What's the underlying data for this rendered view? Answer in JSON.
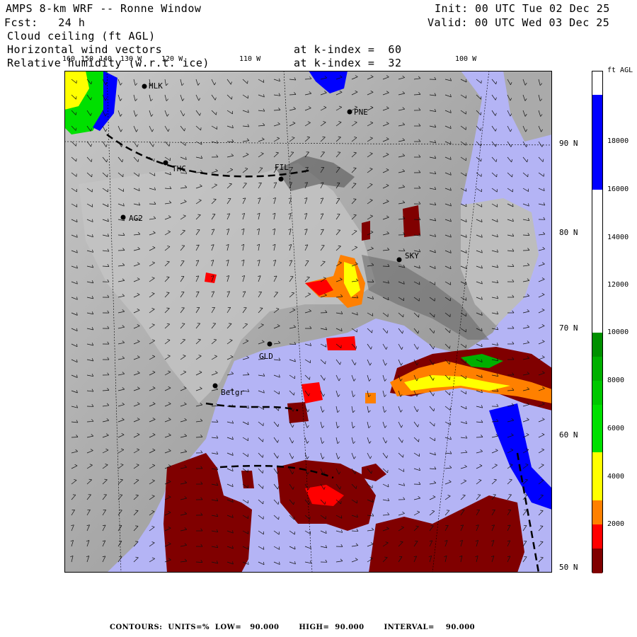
{
  "header": {
    "title": "AMPS 8-km WRF -- Ronne Window",
    "forecast": "Fcst:   24 h",
    "field1": "Cloud ceiling (ft AGL)",
    "field2": "Horizontal wind vectors",
    "field3": "Relative humidity (w.r.t. ice)",
    "k_index_1": "at k-index =  60",
    "k_index_2": "at k-index =  32",
    "init": "Init: 00 UTC Tue 02 Dec 25",
    "valid": "Valid: 00 UTC Wed 03 Dec 25"
  },
  "map": {
    "longitude_labels": [
      "160",
      "150",
      "140",
      "130 W",
      "120 W",
      "110 W",
      "100 W"
    ],
    "latitude_labels": [
      "90 N",
      "80 N",
      "70 N",
      "60 N",
      "50 N"
    ],
    "stations": [
      "HLK",
      "PNE",
      "THC",
      "FIL",
      "AG2",
      "SKY",
      "GLD",
      "Belgr"
    ]
  },
  "colorbar": {
    "unit": "ft AGL",
    "labels": [
      "18000",
      "16000",
      "14000",
      "12000",
      "10000",
      "8000",
      "6000",
      "4000",
      "2000"
    ],
    "colors": [
      "#800000",
      "#ff0000",
      "#ff8000",
      "#ffff00",
      "#00e000",
      "#00b000",
      "#009000",
      "#ffffff",
      "#0000ff"
    ]
  },
  "footer": {
    "contours": "CONTOURS:  UNITS=%  LOW=   90.000       HIGH=  90.000       INTERVAL=    90.000"
  },
  "colors": {
    "ocean_rh": "#b4b4f5",
    "land": "#9a9a9a",
    "cloud_red": "#ff0000",
    "cloud_darkred": "#800000",
    "cloud_blue": "#0000ff"
  }
}
